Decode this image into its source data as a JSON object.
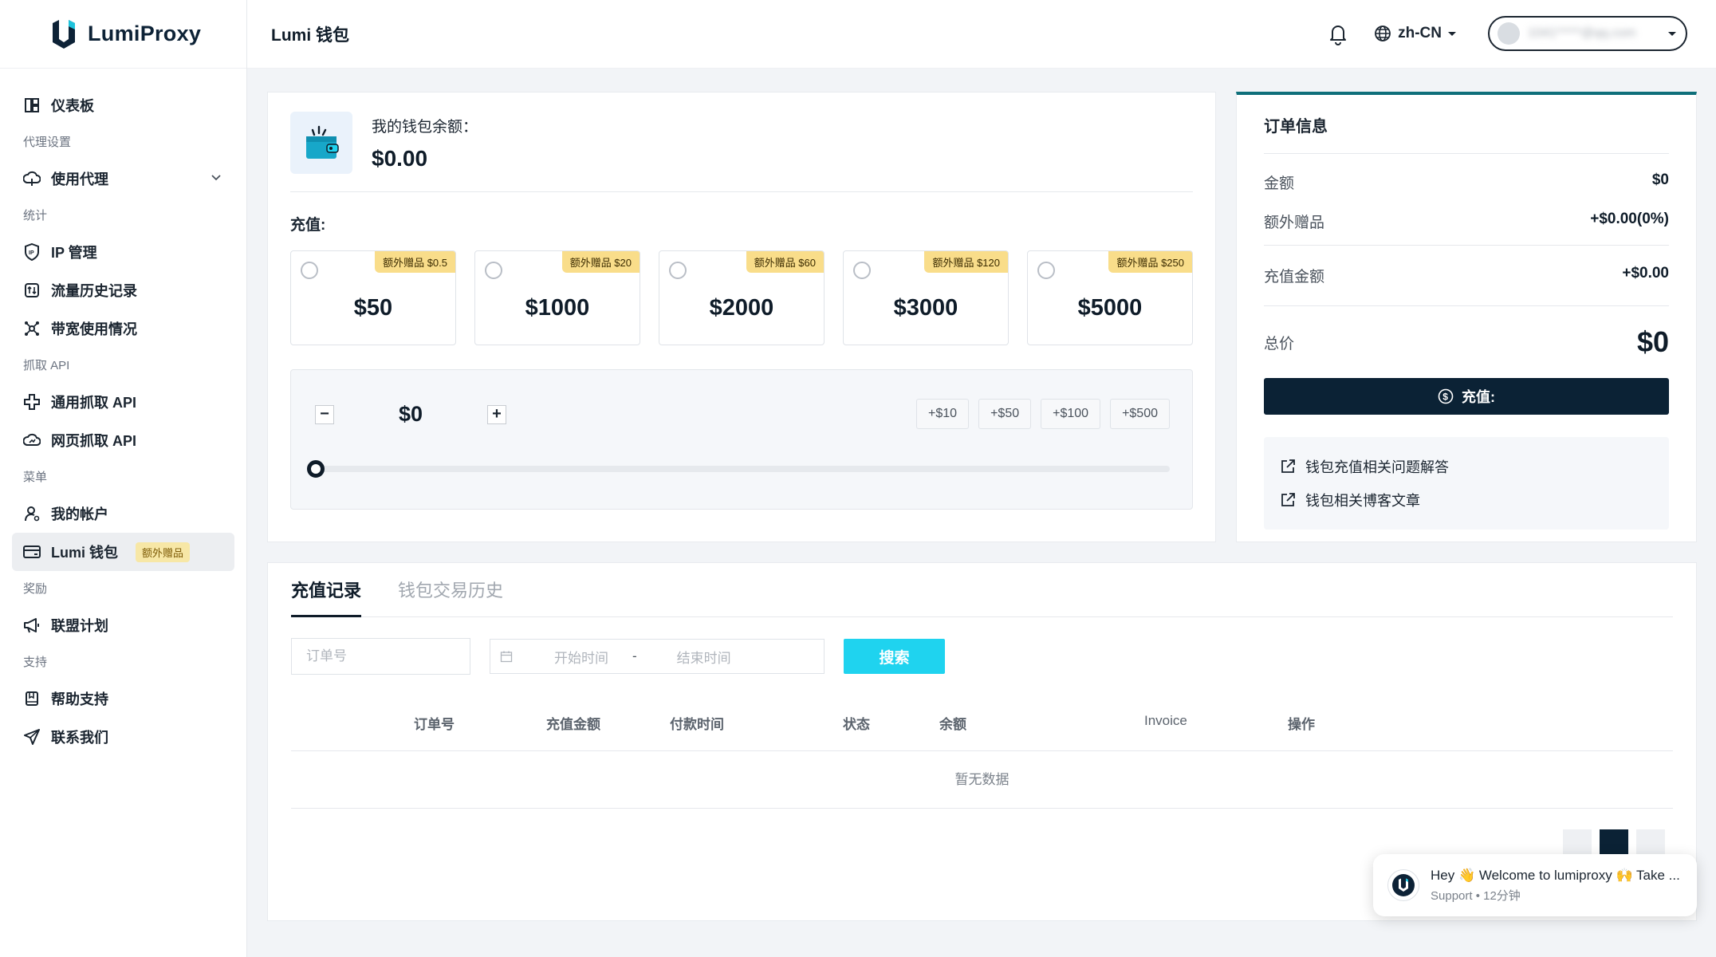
{
  "app": {
    "brand": "LumiProxy",
    "page_title": "Lumi 钱包"
  },
  "header": {
    "lang": "zh-CN",
    "user_email": "1041*****@qq.com"
  },
  "sidebar": {
    "dashboard": "仪表板",
    "group_proxy": "代理设置",
    "use_proxy": "使用代理",
    "group_stats": "统计",
    "ip_manage": "IP 管理",
    "traffic_history": "流量历史记录",
    "bandwidth": "带宽使用情况",
    "group_api": "抓取 API",
    "general_api": "通用抓取 API",
    "web_api": "网页抓取 API",
    "group_menu": "菜单",
    "my_account": "我的帐户",
    "wallet": "Lumi 钱包",
    "wallet_badge": "额外赠品",
    "group_reward": "奖励",
    "affiliate": "联盟计划",
    "group_support": "支持",
    "help": "帮助支持",
    "contact": "联系我们"
  },
  "wallet": {
    "balance_label": "我的钱包余额：",
    "balance_value": "$0.00",
    "recharge_label": "充值:",
    "packages": [
      {
        "amount": "$50",
        "bonus": "额外赠品 $0.5"
      },
      {
        "amount": "$1000",
        "bonus": "额外赠品 $20"
      },
      {
        "amount": "$2000",
        "bonus": "额外赠品 $60"
      },
      {
        "amount": "$3000",
        "bonus": "额外赠品 $120"
      },
      {
        "amount": "$5000",
        "bonus": "额外赠品 $250"
      }
    ],
    "custom_value": "$0",
    "minus": "−",
    "plus": "+",
    "quick": [
      "+$10",
      "+$50",
      "+$100",
      "+$500"
    ],
    "slider_level": 0
  },
  "order": {
    "title": "订单信息",
    "amount_label": "金额",
    "amount_value": "$0",
    "bonus_label": "额外赠品",
    "bonus_value": "+$0.00(0%)",
    "recharge_label": "充值金额",
    "recharge_value": "+$0.00",
    "total_label": "总价",
    "total_value": "$0",
    "pay_button": "充值:",
    "link_faq": "钱包充值相关问题解答",
    "link_blog": "钱包相关博客文章"
  },
  "records": {
    "tab_recharge": "充值记录",
    "tab_history": "钱包交易历史",
    "order_placeholder": "订单号",
    "start_placeholder": "开始时间",
    "dash": "-",
    "end_placeholder": "结束时间",
    "search_button": "搜索",
    "columns": [
      "订单号",
      "充值金额",
      "付款时间",
      "状态",
      "余额",
      "Invoice",
      "操作"
    ],
    "empty": "暂无数据"
  },
  "chat": {
    "message": "Hey 👋 Welcome to lumiproxy 🙌 Take ...",
    "sub": "Support • 12分钟"
  },
  "colors": {
    "accent": "#1fd3ef",
    "navy": "#0b2235",
    "teal": "#0e6f7a",
    "bonus": "#f9dd8a"
  }
}
